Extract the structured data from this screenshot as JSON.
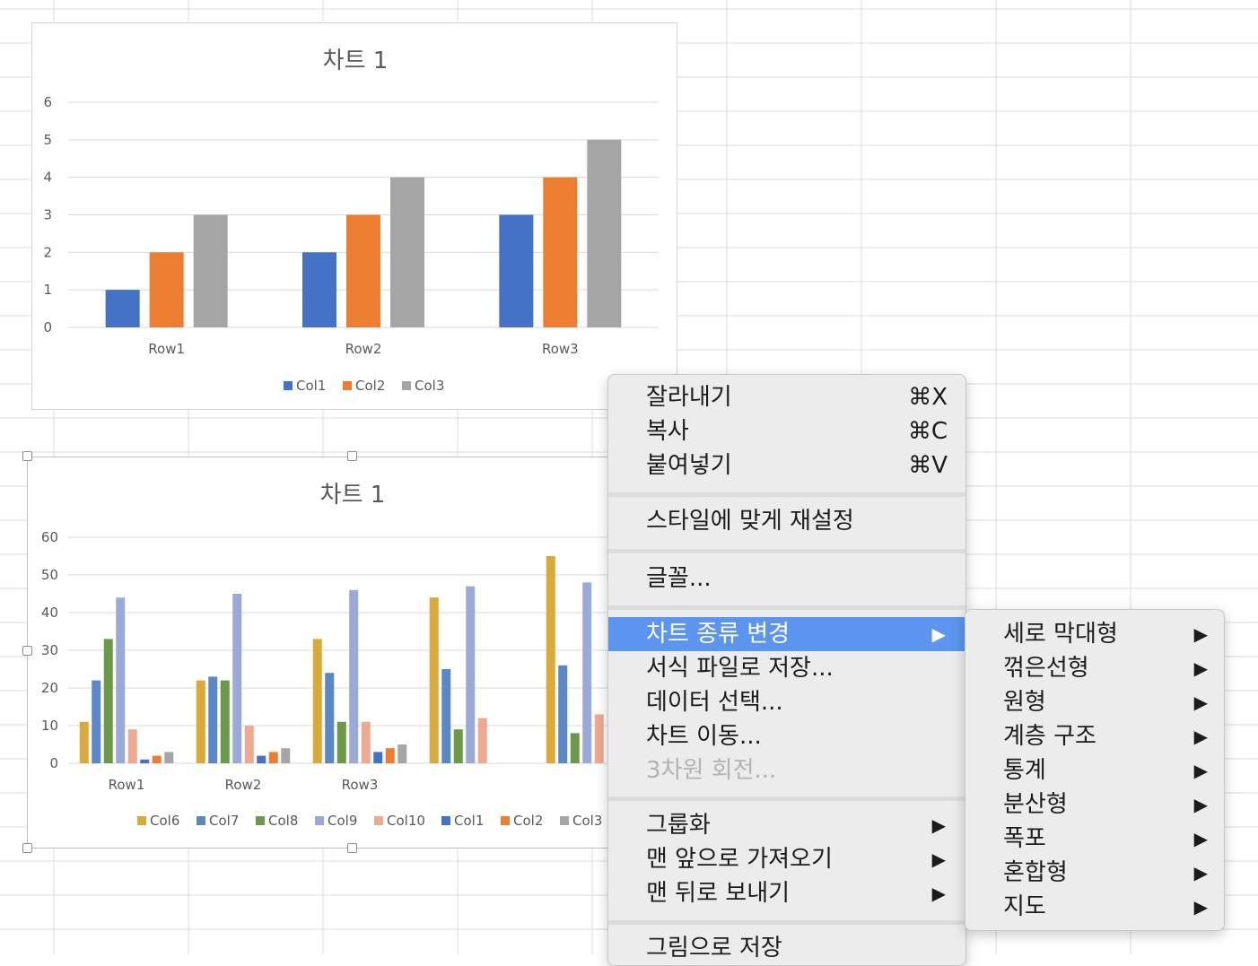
{
  "chart_data": [
    {
      "type": "bar",
      "title": "차트 1",
      "categories": [
        "Row1",
        "Row2",
        "Row3"
      ],
      "ylim": [
        0,
        6
      ],
      "yticks": [
        0,
        1,
        2,
        3,
        4,
        5,
        6
      ],
      "grid": true,
      "legend_position": "bottom",
      "series": [
        {
          "name": "Col1",
          "color": "#4472c4",
          "values": [
            1,
            2,
            3
          ]
        },
        {
          "name": "Col2",
          "color": "#ed7d31",
          "values": [
            2,
            3,
            4
          ]
        },
        {
          "name": "Col3",
          "color": "#a5a5a5",
          "values": [
            3,
            4,
            5
          ]
        }
      ]
    },
    {
      "type": "bar",
      "title": "차트 1",
      "categories": [
        "Row1",
        "Row2",
        "Row3",
        "",
        ""
      ],
      "ylim": [
        0,
        60
      ],
      "yticks": [
        0,
        10,
        20,
        30,
        40,
        50,
        60
      ],
      "grid": true,
      "legend_position": "bottom",
      "selected": true,
      "series": [
        {
          "name": "Col6",
          "color": "#d9a93a",
          "values": [
            11,
            22,
            33,
            44,
            55
          ]
        },
        {
          "name": "Col7",
          "color": "#5b87c5",
          "values": [
            22,
            23,
            24,
            25,
            26
          ]
        },
        {
          "name": "Col8",
          "color": "#6a9a47",
          "values": [
            33,
            22,
            11,
            9,
            8
          ]
        },
        {
          "name": "Col9",
          "color": "#9aaad8",
          "values": [
            44,
            45,
            46,
            47,
            48
          ]
        },
        {
          "name": "Col10",
          "color": "#eeaa90",
          "values": [
            9,
            10,
            11,
            12,
            13
          ]
        },
        {
          "name": "Col1",
          "color": "#4472c4",
          "values": [
            1,
            2,
            3,
            null,
            null
          ]
        },
        {
          "name": "Col2",
          "color": "#ed7d31",
          "values": [
            2,
            3,
            4,
            null,
            null
          ]
        },
        {
          "name": "Col3",
          "color": "#a5a5a5",
          "values": [
            3,
            4,
            5,
            null,
            null
          ]
        }
      ]
    }
  ],
  "context_menu": {
    "items": [
      {
        "label": "잘라내기",
        "shortcut": "⌘X",
        "name": "menu-item-cut"
      },
      {
        "label": "복사",
        "shortcut": "⌘C",
        "name": "menu-item-copy"
      },
      {
        "label": "붙여넣기",
        "shortcut": "⌘V",
        "name": "menu-item-paste"
      },
      {
        "label": "스타일에 맞게 재설정",
        "name": "menu-item-reset-style"
      },
      {
        "label": "글꼴...",
        "name": "menu-item-font"
      },
      {
        "label": "차트 종류 변경",
        "has_submenu": true,
        "highlighted": true,
        "name": "menu-item-change-chart-type"
      },
      {
        "label": "서식 파일로 저장...",
        "name": "menu-item-save-template"
      },
      {
        "label": "데이터 선택...",
        "name": "menu-item-select-data"
      },
      {
        "label": "차트 이동...",
        "name": "menu-item-move-chart"
      },
      {
        "label": "3차원 회전...",
        "disabled": true,
        "name": "menu-item-3d-rotation"
      },
      {
        "label": "그룹화",
        "has_submenu": true,
        "name": "menu-item-group"
      },
      {
        "label": "맨 앞으로 가져오기",
        "has_submenu": true,
        "name": "menu-item-bring-to-front"
      },
      {
        "label": "맨 뒤로 보내기",
        "has_submenu": true,
        "name": "menu-item-send-to-back"
      },
      {
        "label": "그림으로 저장",
        "name": "menu-item-save-as-picture"
      }
    ],
    "arrow": "▶"
  },
  "submenu": {
    "items": [
      {
        "label": "세로 막대형",
        "name": "submenu-item-column"
      },
      {
        "label": "꺾은선형",
        "name": "submenu-item-line"
      },
      {
        "label": "원형",
        "name": "submenu-item-pie"
      },
      {
        "label": "계층 구조",
        "name": "submenu-item-hierarchy"
      },
      {
        "label": "통계",
        "name": "submenu-item-statistic"
      },
      {
        "label": "분산형",
        "name": "submenu-item-scatter"
      },
      {
        "label": "폭포",
        "name": "submenu-item-waterfall"
      },
      {
        "label": "혼합형",
        "name": "submenu-item-combo"
      },
      {
        "label": "지도",
        "name": "submenu-item-map"
      }
    ]
  },
  "colors": {
    "menu_highlight": "#5b95ef",
    "gridline": "#d9d9d9",
    "sheet_grid": "#dcdcdc"
  }
}
